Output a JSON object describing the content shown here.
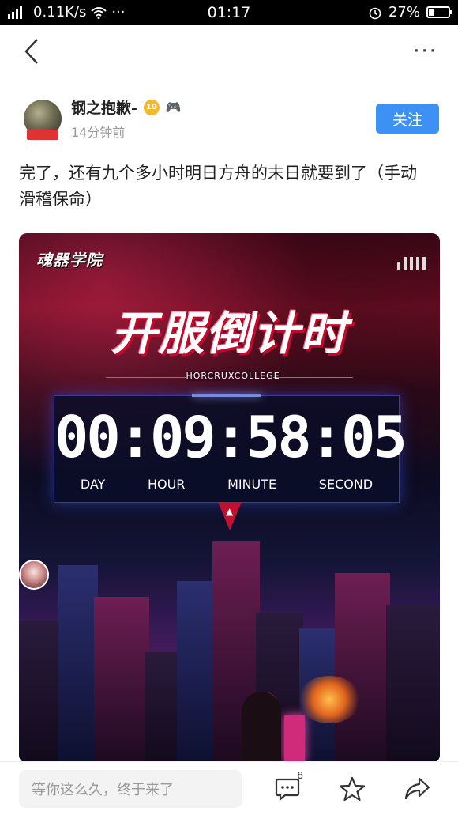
{
  "status": {
    "signal": "4G",
    "speed": "0.11K/s",
    "time": "01:17",
    "battery": "27%",
    "battery_level": 0.27
  },
  "author": {
    "name": "钢之抱歉-",
    "level": "10",
    "time": "14分钟前",
    "follow_label": "关注"
  },
  "post": {
    "text": "完了，还有九个多小时明日方舟的末日就要到了（手动滑稽保命）"
  },
  "image": {
    "academy_logo": "魂器学院",
    "title": "开服倒计时",
    "college": "HORCRUXCOLLEGE",
    "timer": "00:09:58:05",
    "labels": [
      "DAY",
      "HOUR",
      "MINUTE",
      "SECOND"
    ]
  },
  "bottom": {
    "comment_placeholder": "等你这么久，终于来了",
    "comment_count": "8"
  }
}
